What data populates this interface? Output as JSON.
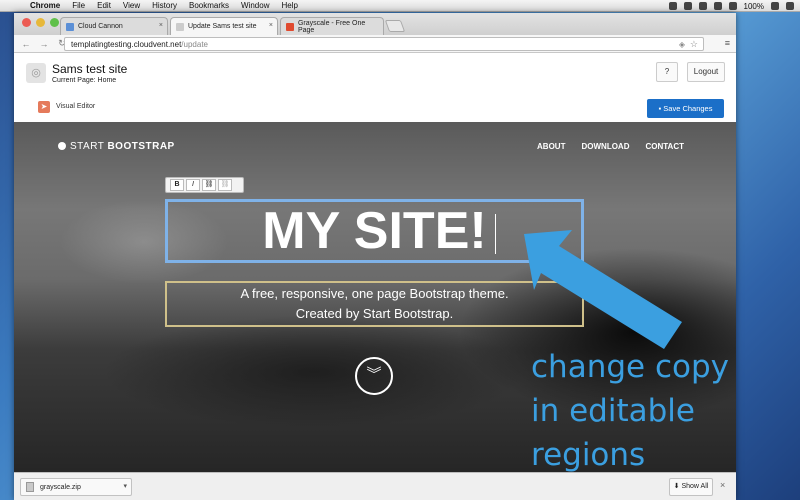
{
  "menubar": {
    "app": "Chrome",
    "items": [
      "File",
      "Edit",
      "View",
      "History",
      "Bookmarks",
      "Window",
      "Help"
    ],
    "battery": "100%"
  },
  "browser": {
    "tabs": [
      {
        "label": "Cloud Cannon",
        "favicon_color": "#5b8fd6"
      },
      {
        "label": "Update Sams test site",
        "favicon_color": "#cccccc"
      },
      {
        "label": "Grayscale - Free One Page",
        "favicon_color": "#e04a2f"
      }
    ],
    "url_host": "templatingtesting.cloudvent.net",
    "url_path": "/update"
  },
  "cms": {
    "site_name": "Sams test site",
    "current_page": "Current Page: Home",
    "help_label": "?",
    "logout_label": "Logout",
    "visual_editor_label": "Visual Editor",
    "save_label": "Save Changes"
  },
  "hero": {
    "brand_light": "START ",
    "brand_bold": "BOOTSTRAP",
    "nav": [
      "ABOUT",
      "DOWNLOAD",
      "CONTACT"
    ],
    "toolbar": [
      "B",
      "I",
      "⛓",
      "⛓"
    ],
    "title": "MY SITE!",
    "subtitle_line1": "A free, responsive, one page Bootstrap theme.",
    "subtitle_line2": "Created by Start Bootstrap.",
    "scroll_icon": "double-chevron-down-icon"
  },
  "annotation": {
    "line1": "change copy",
    "line2": "in editable",
    "line3": "regions",
    "color": "#3b9fe0"
  },
  "downloads": {
    "file": "grayscale.zip",
    "show_all": "Show All"
  },
  "colors": {
    "save_button": "#1b6fc8",
    "title_border": "#7fb2e8",
    "subtitle_border": "#cfc08a"
  }
}
